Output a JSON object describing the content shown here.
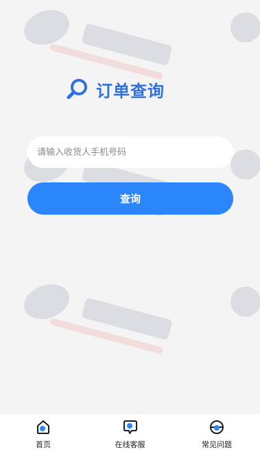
{
  "header": {
    "title": "订单查询",
    "title_icon": "search-icon"
  },
  "search": {
    "placeholder": "请输入收货人手机号码",
    "value": ""
  },
  "actions": {
    "query_label": "查询"
  },
  "bottom_nav": {
    "items": [
      {
        "label": "首页",
        "icon": "home-icon"
      },
      {
        "label": "在线客服",
        "icon": "chat-icon"
      },
      {
        "label": "常见问题",
        "icon": "help-icon"
      }
    ]
  },
  "colors": {
    "accent": "#2b86fb",
    "title": "#2f6fe0",
    "background": "#f4f4f4"
  }
}
